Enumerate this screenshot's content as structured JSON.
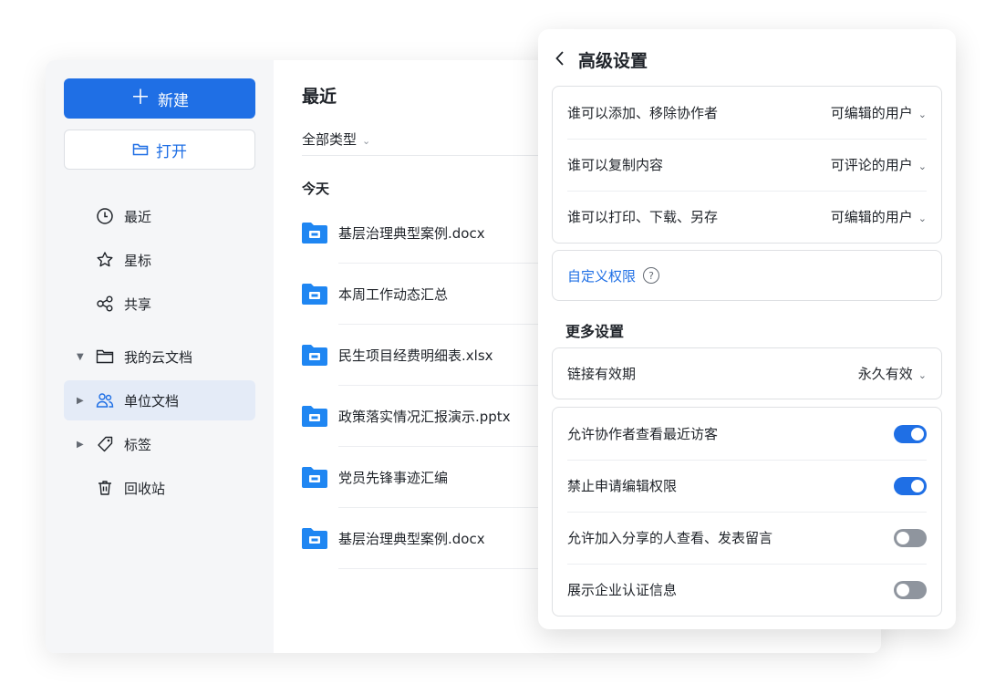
{
  "sidebar": {
    "new_label": "新建",
    "open_label": "打开",
    "items": [
      {
        "label": "最近"
      },
      {
        "label": "星标"
      },
      {
        "label": "共享"
      },
      {
        "label": "我的云文档"
      },
      {
        "label": "单位文档"
      },
      {
        "label": "标签"
      },
      {
        "label": "回收站"
      }
    ]
  },
  "main": {
    "title": "最近",
    "type_filter": "全部类型",
    "section": "今天",
    "files": [
      {
        "name": "基层治理典型案例.docx"
      },
      {
        "name": "本周工作动态汇总"
      },
      {
        "name": "民生项目经费明细表.xlsx"
      },
      {
        "name": "政策落实情况汇报演示.pptx"
      },
      {
        "name": "党员先锋事迹汇编"
      },
      {
        "name": "基层治理典型案例.docx"
      }
    ]
  },
  "panel": {
    "back_icon": "chevron-left-icon",
    "title": "高级设置",
    "permissions": [
      {
        "label": "谁可以添加、移除协作者",
        "value": "可编辑的用户"
      },
      {
        "label": "谁可以复制内容",
        "value": "可评论的用户"
      },
      {
        "label": "谁可以打印、下载、另存",
        "value": "可编辑的用户"
      }
    ],
    "custom_permission": "自定义权限",
    "more_settings_title": "更多设置",
    "link_validity": {
      "label": "链接有效期",
      "value": "永久有效"
    },
    "toggles": [
      {
        "label": "允许协作者查看最近访客",
        "on": true
      },
      {
        "label": "禁止申请编辑权限",
        "on": true
      },
      {
        "label": "允许加入分享的人查看、发表留言",
        "on": false
      },
      {
        "label": "展示企业认证信息",
        "on": false
      }
    ]
  },
  "colors": {
    "accent": "#1f6fe5",
    "active_bg": "#e4ebf7",
    "sidebar_bg": "#f5f6f8",
    "toggle_off": "#8f959e"
  }
}
